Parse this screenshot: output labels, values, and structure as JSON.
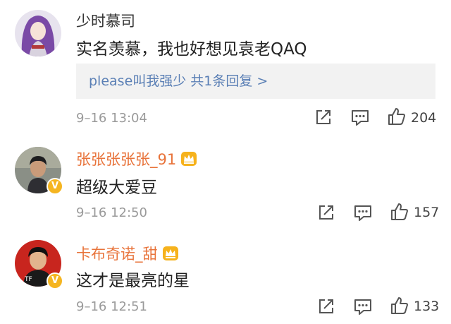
{
  "comments": [
    {
      "username": "少时慕司",
      "content": "实名羡慕，我也好想见袁老QAQ",
      "reply_summary": "please叫我强少  共1条回复 >",
      "time": "9–16 13:04",
      "likes": "204"
    },
    {
      "username": "张张张张张_91",
      "content": "超级大爱豆",
      "time": "9–16 12:50",
      "likes": "157"
    },
    {
      "username": "卡布奇诺_甜",
      "content": "这才是最亮的星",
      "time": "9–16 12:51",
      "likes": "133"
    }
  ],
  "badge_text": "V",
  "icons": [
    "share-icon",
    "comment-icon",
    "like-icon",
    "crown-icon"
  ],
  "colors": {
    "vip_name": "#e8733a",
    "reply_link": "#5a7fb5",
    "reply_bg": "#f2f2f2",
    "timestamp": "#9a9a9a",
    "verified_badge": "#f5b521"
  }
}
